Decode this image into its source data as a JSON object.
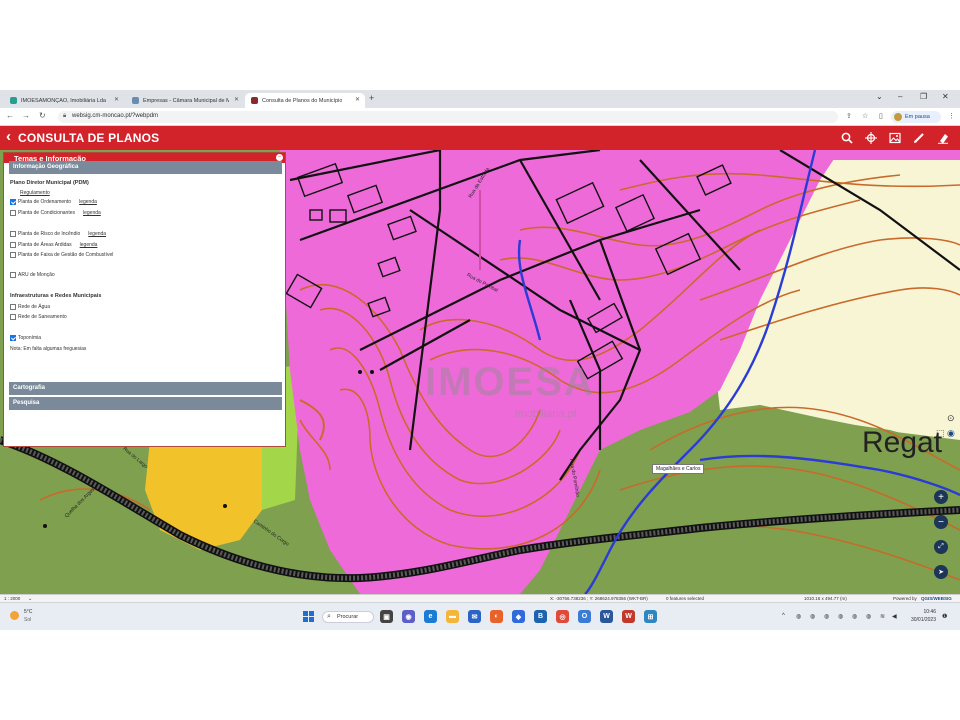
{
  "browser": {
    "tabs": [
      {
        "label": "IMOESAMONÇÃO, Imobiliária Lda",
        "favicon_color": "#2a9d8f"
      },
      {
        "label": "Empresas - Câmara Municipal de Monção",
        "favicon_color": "#6a8caf"
      },
      {
        "label": "Consulta de Planos do Município",
        "favicon_color": "#8b2a2a"
      }
    ],
    "new_tab": "+",
    "url": "websig.cm-moncao.pt/?webpdm",
    "profile_label": "Em pausa"
  },
  "app": {
    "title": "CONSULTA DE PLANOS",
    "accent_color": "#d3232a",
    "tools": [
      "search-icon",
      "crosshair-icon",
      "image-icon",
      "pencil-icon",
      "eraser-icon"
    ]
  },
  "panel": {
    "title": "Temas e Informação",
    "section_geo": "Informação Geográfica",
    "pdm_header": "Plano Diretor Municipal (PDM)",
    "regulamento": "Regulamento",
    "layers_pdm": [
      {
        "label": "Planta de Ordenamento",
        "legend": "legenda",
        "checked": true
      },
      {
        "label": "Planta de Condicionantes",
        "legend": "legenda",
        "checked": false
      },
      {
        "label": "Planta de Risco de Incêndio",
        "legend": "legenda",
        "checked": false
      },
      {
        "label": "Planta de Áreas Ardidas",
        "legend": "legenda",
        "checked": false
      },
      {
        "label": "Planta de Faixa de Gestão de Combustível",
        "legend": "",
        "checked": false
      }
    ],
    "aru_label": "ARU de Monção",
    "infra_header": "Infraestruturas e Redes Municipais",
    "layers_infra": [
      {
        "label": "Rede de Água",
        "checked": false
      },
      {
        "label": "Rede de Saneamento",
        "checked": false
      }
    ],
    "topo_label": "Toponímia",
    "note": "Nota: Em falta algumas freguesias",
    "section_carto": "Cartografia",
    "section_search": "Pesquisa"
  },
  "map": {
    "watermark": "IMOESA",
    "watermark_sub": "imobiliaria.pt",
    "place_label": "Regat",
    "tag_label": "Magalhães e Carlos",
    "streets": [
      "Rua da Estrada",
      "Rua do Pombal",
      "Rua do Pomilhão",
      "Caminho do Corgo",
      "Quelha dos Argas",
      "Rua do Largo"
    ]
  },
  "statusbar": {
    "scale": "1 : 2000",
    "coords": "X: -30766.738236 ; Y: 268624.978356 (WKT-BR)",
    "features": "0 features selected",
    "size": "1010.16 x 494.77 (m)",
    "powered": "Powered by",
    "brand": "QGIS/WEBSIG"
  },
  "taskbar": {
    "temp": "5°C",
    "cond": "Sol",
    "search": "Procurar",
    "time": "10:46",
    "date": "30/01/2023"
  }
}
